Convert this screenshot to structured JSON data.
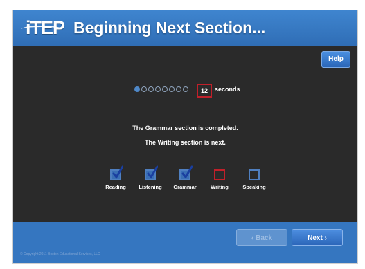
{
  "header": {
    "logo_text": "iTEP",
    "title": "Beginning Next Section..."
  },
  "toolbar": {
    "help_label": "Help"
  },
  "timer": {
    "dots_total": 8,
    "dots_filled": 1,
    "value": "12",
    "unit_label": "seconds"
  },
  "messages": {
    "completed": "The Grammar section is completed.",
    "next": "The Writing section is next."
  },
  "sections": [
    {
      "label": "Reading",
      "status": "done"
    },
    {
      "label": "Listening",
      "status": "done"
    },
    {
      "label": "Grammar",
      "status": "done"
    },
    {
      "label": "Writing",
      "status": "current"
    },
    {
      "label": "Speaking",
      "status": "pending"
    }
  ],
  "footer": {
    "back_label": "‹ Back",
    "next_label": "Next ›",
    "copyright": "© Copyright 2011 Boston Educational Services, LLC"
  },
  "colors": {
    "header_blue": "#3576c0",
    "panel_dark": "#2a2a2a",
    "current_red": "#c0202a",
    "check_blue": "#1a3fa0"
  }
}
